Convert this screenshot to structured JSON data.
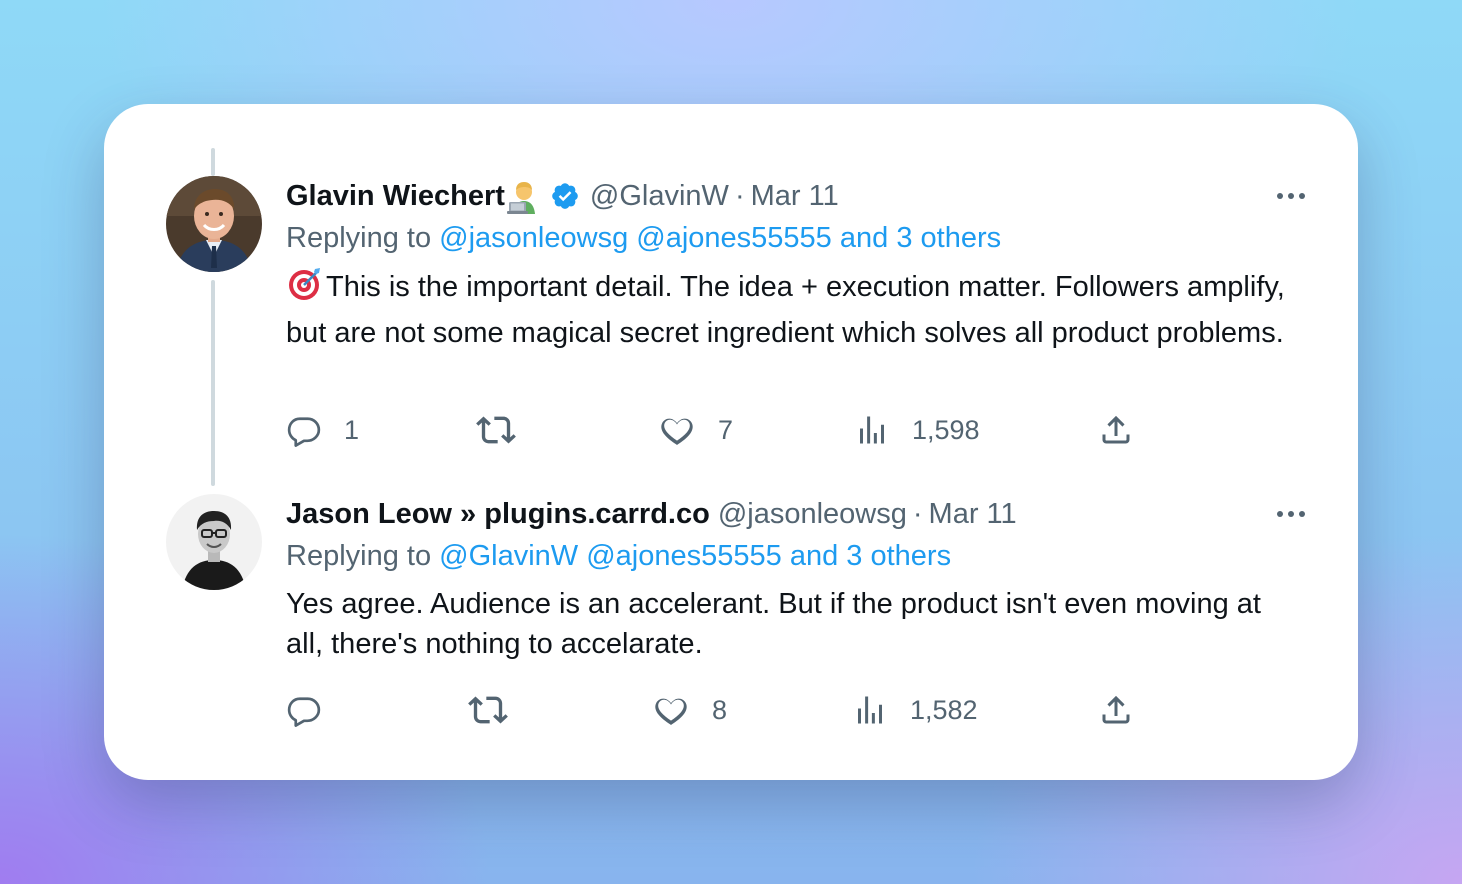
{
  "tweets": [
    {
      "name": "Glavin Wiechert",
      "name_emoji": "technologist-emoji",
      "verified": true,
      "handle": "@GlavinW",
      "separator": "·",
      "date": "Mar 11",
      "replying_label": "Replying to",
      "replying_mentions": [
        "@jasonleowsg",
        "@ajones55555"
      ],
      "replying_others": "and 3 others",
      "body_emoji": "direct-hit-emoji",
      "body": "This is the important detail. The idea + execution matter. Followers amplify, but are not some magical secret ingredient which solves all product problems.",
      "actions": {
        "replies": "1",
        "retweets": "",
        "likes": "7",
        "views": "1,598"
      }
    },
    {
      "name": "Jason Leow » plugins.carrd.co",
      "verified": false,
      "handle": "@jasonleowsg",
      "separator": "·",
      "date": "Mar 11",
      "replying_label": "Replying to",
      "replying_mentions": [
        "@GlavinW",
        "@ajones55555"
      ],
      "replying_others": "and 3 others",
      "body": "Yes agree. Audience is an accelerant. But if the product isn't even moving at all, there's nothing to accelarate.",
      "actions": {
        "replies": "",
        "retweets": "",
        "likes": "8",
        "views": "1,582"
      }
    }
  ],
  "colors": {
    "link": "#1d9bf0",
    "secondary_text": "#536471",
    "primary_text": "#0f1419",
    "thread_line": "#cfd9de"
  }
}
